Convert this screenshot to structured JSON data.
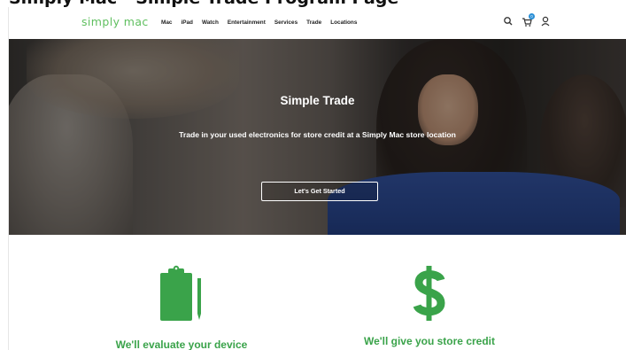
{
  "caption": "Simply Mac - Simple Trade Program Page",
  "header": {
    "logo": "simply mac",
    "nav": [
      "Mac",
      "iPad",
      "Watch",
      "Entertainment",
      "Services",
      "Trade",
      "Locations"
    ],
    "icons": [
      "search-icon",
      "cart-icon",
      "user-icon"
    ],
    "cart_badge": "0"
  },
  "hero": {
    "title": "Simple Trade",
    "subtitle": "Trade in your used electronics for store credit at a Simply Mac store location",
    "cta": "Let's Get Started"
  },
  "features": [
    {
      "icon": "clipboard-icon",
      "label": "We'll evaluate your device"
    },
    {
      "icon": "dollar-icon",
      "label": "We'll give you store credit"
    }
  ],
  "colors": {
    "brand_green": "#5fbf5f",
    "feature_green": "#3aa34a",
    "badge_blue": "#2a8fd6"
  }
}
